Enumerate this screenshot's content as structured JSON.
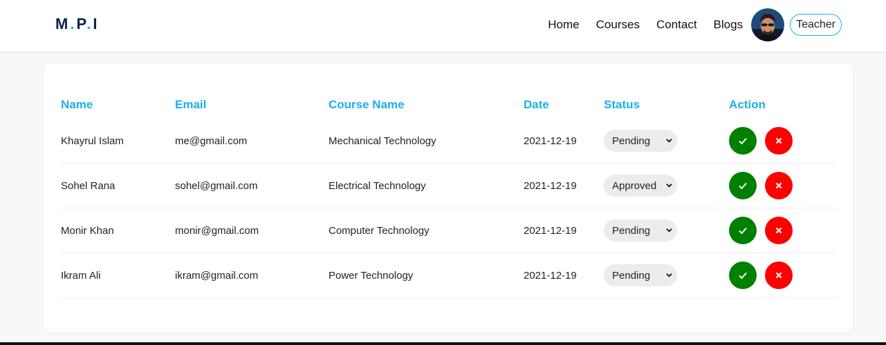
{
  "brand": {
    "logo_letters": [
      "M",
      "P",
      "I"
    ],
    "logo_sep": "."
  },
  "nav": {
    "links": [
      "Home",
      "Courses",
      "Contact",
      "Blogs"
    ],
    "teacher_label": "Teacher"
  },
  "table": {
    "headers": [
      "Name",
      "Email",
      "Course Name",
      "Date",
      "Status",
      "Action"
    ],
    "rows": [
      {
        "name": "Khayrul Islam",
        "email": "me@gmail.com",
        "course": "Mechanical Technology",
        "date": "2021-12-19",
        "status": "Pending"
      },
      {
        "name": "Sohel Rana",
        "email": "sohel@gmail.com",
        "course": "Electrical Technology",
        "date": "2021-12-19",
        "status": "Approved"
      },
      {
        "name": "Monir Khan",
        "email": "monir@gmail.com",
        "course": "Computer Technology",
        "date": "2021-12-19",
        "status": "Pending"
      },
      {
        "name": "Ikram Ali",
        "email": "ikram@gmail.com",
        "course": "Power Technology",
        "date": "2021-12-19",
        "status": "Pending"
      }
    ]
  },
  "icons": {
    "approve": "check-icon",
    "reject": "close-icon",
    "status_dropdown": "chevron-down-icon"
  },
  "colors": {
    "accent": "#1ab0ea",
    "logo": "#0b2447",
    "approve": "#008000",
    "reject": "#ff0000"
  }
}
